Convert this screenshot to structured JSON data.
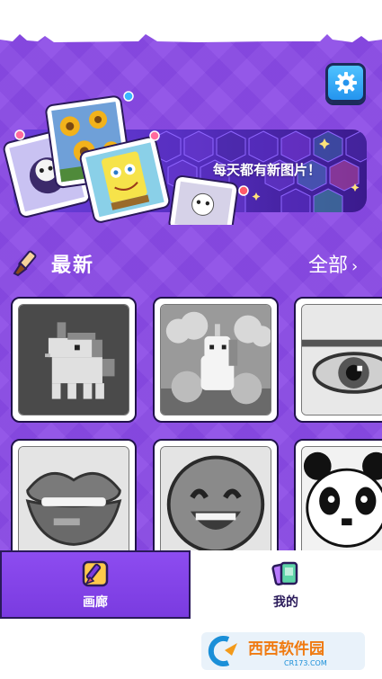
{
  "settings": {
    "icon": "gear-icon"
  },
  "banner": {
    "text": "每天都有新图片！"
  },
  "section": {
    "title": "最新",
    "view_all": "全部",
    "chevron": "›",
    "icon": "paintbrush-icon"
  },
  "gallery": {
    "items": [
      {
        "name": "unicorn-pixel"
      },
      {
        "name": "unicorn-cloud"
      },
      {
        "name": "eye"
      },
      {
        "name": "lips"
      },
      {
        "name": "smiley-face"
      },
      {
        "name": "panda"
      }
    ]
  },
  "tabs": [
    {
      "label": "画廊",
      "icon": "gallery-icon",
      "active": true
    },
    {
      "label": "我的",
      "icon": "cards-icon",
      "active": false
    }
  ],
  "watermark": {
    "brand": "西西软件园",
    "sub": "CR173.COM"
  },
  "colors": {
    "accent": "#8a49e6",
    "tab_active": "#7a3be0",
    "settings_blue": "#2494ee"
  }
}
